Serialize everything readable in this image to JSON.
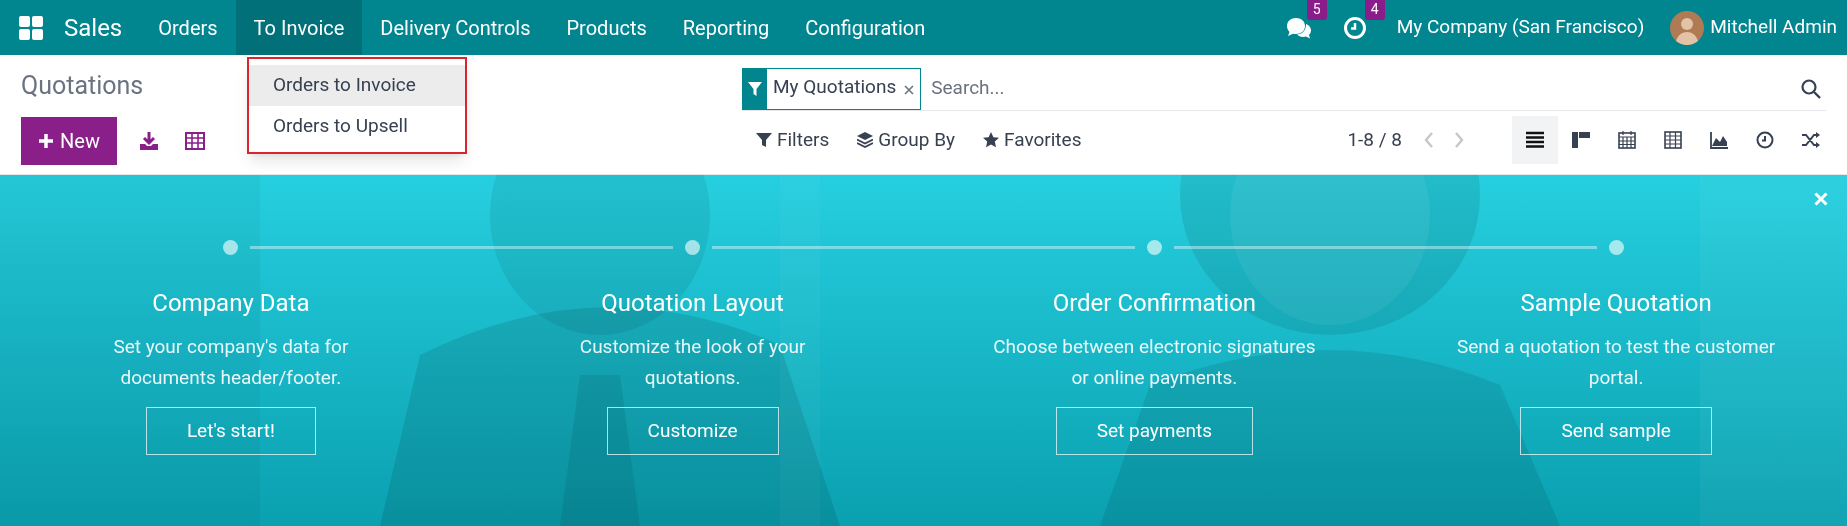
{
  "app": {
    "name": "Sales"
  },
  "menu": [
    {
      "label": "Orders",
      "selected": false
    },
    {
      "label": "To Invoice",
      "selected": true
    },
    {
      "label": "Delivery Controls",
      "selected": false
    },
    {
      "label": "Products",
      "selected": false
    },
    {
      "label": "Reporting",
      "selected": false
    },
    {
      "label": "Configuration",
      "selected": false
    }
  ],
  "systray": {
    "messages_count": "5",
    "activities_count": "4",
    "company": "My Company (San Francisco)",
    "user": "Mitchell Admin"
  },
  "dropdown": {
    "items": [
      {
        "label": "Orders to Invoice",
        "selected": true
      },
      {
        "label": "Orders to Upsell",
        "selected": false
      }
    ]
  },
  "page_title": "Quotations",
  "new_button": "New",
  "search": {
    "facets": [
      {
        "label": "My Quotations"
      }
    ],
    "placeholder": "Search..."
  },
  "search_options": [
    {
      "kind": "filters",
      "label": "Filters"
    },
    {
      "kind": "group_by",
      "label": "Group By"
    },
    {
      "kind": "favorites",
      "label": "Favorites"
    }
  ],
  "pager": "1-8 / 8",
  "views": [
    {
      "kind": "list",
      "selected": true
    },
    {
      "kind": "kanban",
      "selected": false
    },
    {
      "kind": "calendar",
      "selected": false
    },
    {
      "kind": "pivot",
      "selected": false
    },
    {
      "kind": "graph",
      "selected": false
    },
    {
      "kind": "activity",
      "selected": false
    },
    {
      "kind": "cohort",
      "selected": false
    }
  ],
  "onboarding": {
    "steps": [
      {
        "title": "Company Data",
        "description": "Set your company's data for\ndocuments header/footer.",
        "button": "Let's start!"
      },
      {
        "title": "Quotation Layout",
        "description": "Customize the look of your\nquotations.",
        "button": "Customize"
      },
      {
        "title": "Order Confirmation",
        "description": "Choose between electronic signatures\nor online payments.",
        "button": "Set payments"
      },
      {
        "title": "Sample Quotation",
        "description": "Send a quotation to test the customer\nportal.",
        "button": "Send sample"
      }
    ]
  }
}
